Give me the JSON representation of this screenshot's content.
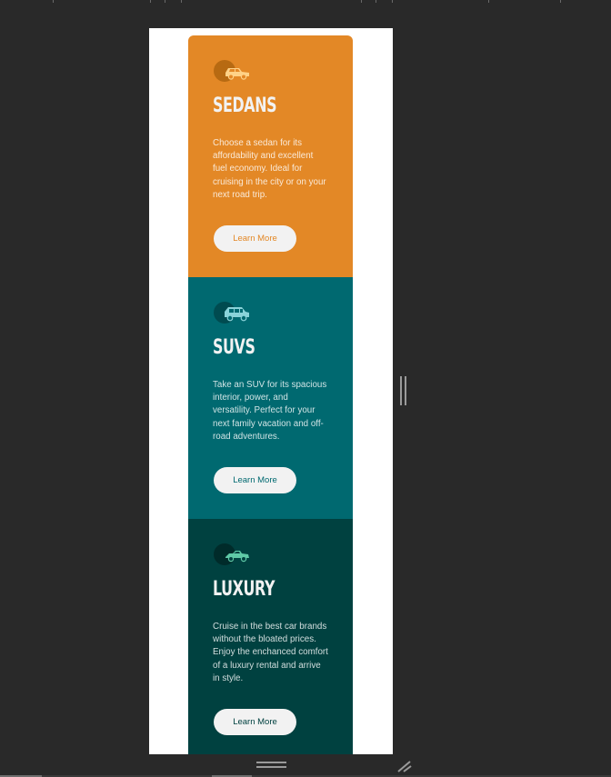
{
  "cards": [
    {
      "key": "sedans",
      "icon": "sedan-car-icon",
      "title": "SEDANS",
      "text": "Choose a sedan for its affordability and excellent fuel economy. Ideal for cruising in the city or on your next road trip.",
      "button_label": "Learn More",
      "color": "#e38826"
    },
    {
      "key": "suvs",
      "icon": "suv-icon",
      "title": "SUVS",
      "text": "Take an SUV for its spacious interior, power, and versatility. Perfect for your next family vacation and off-road adventures.",
      "button_label": "Learn More",
      "color": "#006970"
    },
    {
      "key": "luxury",
      "icon": "luxury-car-icon",
      "title": "LUXURY",
      "text": "Cruise in the best car brands without the bloated prices. Enjoy the enchanced comfort of a luxury rental and arrive in style.",
      "button_label": "Learn More",
      "color": "#004140"
    }
  ],
  "theme": {
    "editor_background": "#292929",
    "canvas_background": "#ffffff",
    "button_background": "#f2f2f2"
  }
}
